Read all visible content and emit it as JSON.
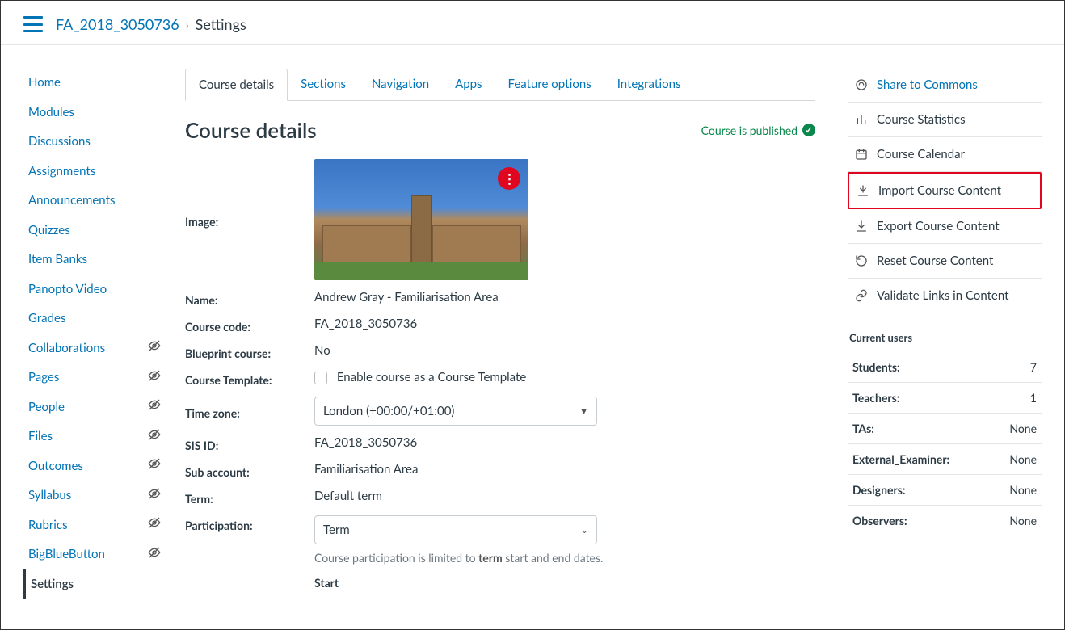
{
  "breadcrumb": {
    "course": "FA_2018_3050736",
    "current": "Settings"
  },
  "leftnav": [
    {
      "label": "Home",
      "hidden": false
    },
    {
      "label": "Modules",
      "hidden": false
    },
    {
      "label": "Discussions",
      "hidden": false
    },
    {
      "label": "Assignments",
      "hidden": false
    },
    {
      "label": "Announcements",
      "hidden": false
    },
    {
      "label": "Quizzes",
      "hidden": false
    },
    {
      "label": "Item Banks",
      "hidden": false
    },
    {
      "label": "Panopto Video",
      "hidden": false
    },
    {
      "label": "Grades",
      "hidden": false
    },
    {
      "label": "Collaborations",
      "hidden": true
    },
    {
      "label": "Pages",
      "hidden": true
    },
    {
      "label": "People",
      "hidden": true
    },
    {
      "label": "Files",
      "hidden": true
    },
    {
      "label": "Outcomes",
      "hidden": true
    },
    {
      "label": "Syllabus",
      "hidden": true
    },
    {
      "label": "Rubrics",
      "hidden": true
    },
    {
      "label": "BigBlueButton",
      "hidden": true
    },
    {
      "label": "Settings",
      "hidden": false,
      "active": true
    }
  ],
  "tabs": [
    "Course details",
    "Sections",
    "Navigation",
    "Apps",
    "Feature options",
    "Integrations"
  ],
  "heading": "Course details",
  "published_text": "Course is published",
  "labels": {
    "image": "Image:",
    "name": "Name:",
    "code": "Course code:",
    "blueprint": "Blueprint course:",
    "template": "Course Template:",
    "tz": "Time zone:",
    "sis": "SIS ID:",
    "subacct": "Sub account:",
    "term": "Term:",
    "participation": "Participation:",
    "start": "Start"
  },
  "values": {
    "name": "Andrew Gray - Familiarisation Area",
    "code": "FA_2018_3050736",
    "blueprint": "No",
    "template_option": "Enable course as a Course Template",
    "timezone": "London (+00:00/+01:00)",
    "sis": "FA_2018_3050736",
    "subacct": "Familiarisation Area",
    "term": "Default term",
    "participation": "Term",
    "participation_help_pre": "Course participation is limited to ",
    "participation_help_bold": "term",
    "participation_help_post": " start and end dates."
  },
  "actions": [
    {
      "label": "Share to Commons",
      "icon": "share",
      "share": true
    },
    {
      "label": "Course Statistics",
      "icon": "stats"
    },
    {
      "label": "Course Calendar",
      "icon": "calendar"
    },
    {
      "label": "Import Course Content",
      "icon": "import",
      "highlight": true
    },
    {
      "label": "Export Course Content",
      "icon": "export"
    },
    {
      "label": "Reset Course Content",
      "icon": "reset"
    },
    {
      "label": "Validate Links in Content",
      "icon": "link"
    }
  ],
  "current_users_title": "Current users",
  "users": [
    {
      "label": "Students:",
      "value": "7"
    },
    {
      "label": "Teachers:",
      "value": "1"
    },
    {
      "label": "TAs:",
      "value": "None"
    },
    {
      "label": "External_Examiner:",
      "value": "None"
    },
    {
      "label": "Designers:",
      "value": "None"
    },
    {
      "label": "Observers:",
      "value": "None"
    }
  ]
}
